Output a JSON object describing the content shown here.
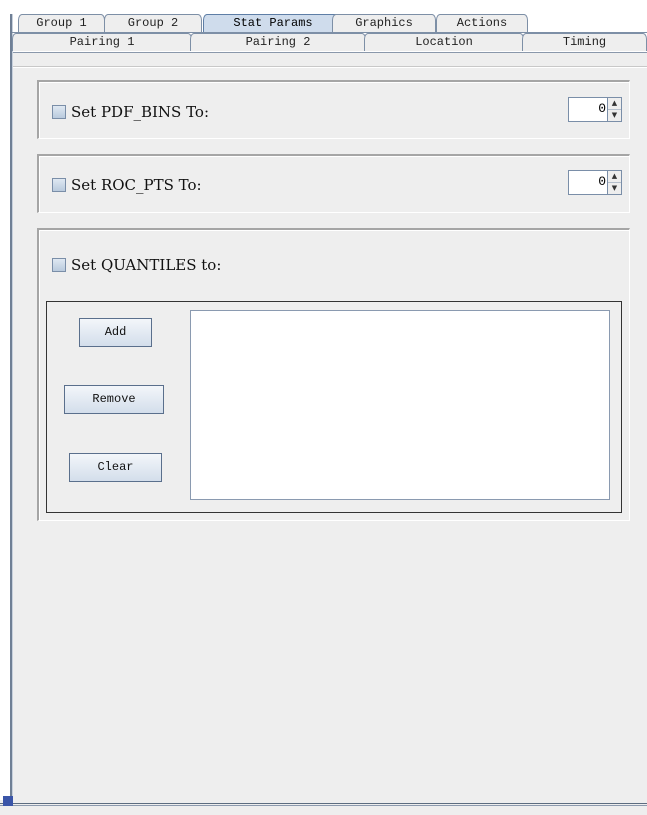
{
  "tabs_row1": [
    {
      "label": "Group 1",
      "selected": false
    },
    {
      "label": "Group 2",
      "selected": false
    },
    {
      "label": "Stat Params",
      "selected": true
    },
    {
      "label": "Graphics",
      "selected": false
    },
    {
      "label": "Actions",
      "selected": false
    }
  ],
  "tabs_row2": [
    {
      "label": "Pairing 1"
    },
    {
      "label": "Pairing 2"
    },
    {
      "label": "Location"
    },
    {
      "label": "Timing"
    }
  ],
  "pdf_bins": {
    "label": "Set PDF_BINS To:",
    "value": "0",
    "checked": false
  },
  "roc_pts": {
    "label": "Set ROC_PTS To:",
    "value": "0",
    "checked": false
  },
  "quantiles": {
    "label": "Set QUANTILES to:",
    "checked": false,
    "add_label": "Add",
    "remove_label": "Remove",
    "clear_label": "Clear",
    "items": []
  },
  "colors": {
    "selected_tab": "#cfdcec",
    "panel_bg": "#eeeeee",
    "border": "#7d8fa6"
  }
}
